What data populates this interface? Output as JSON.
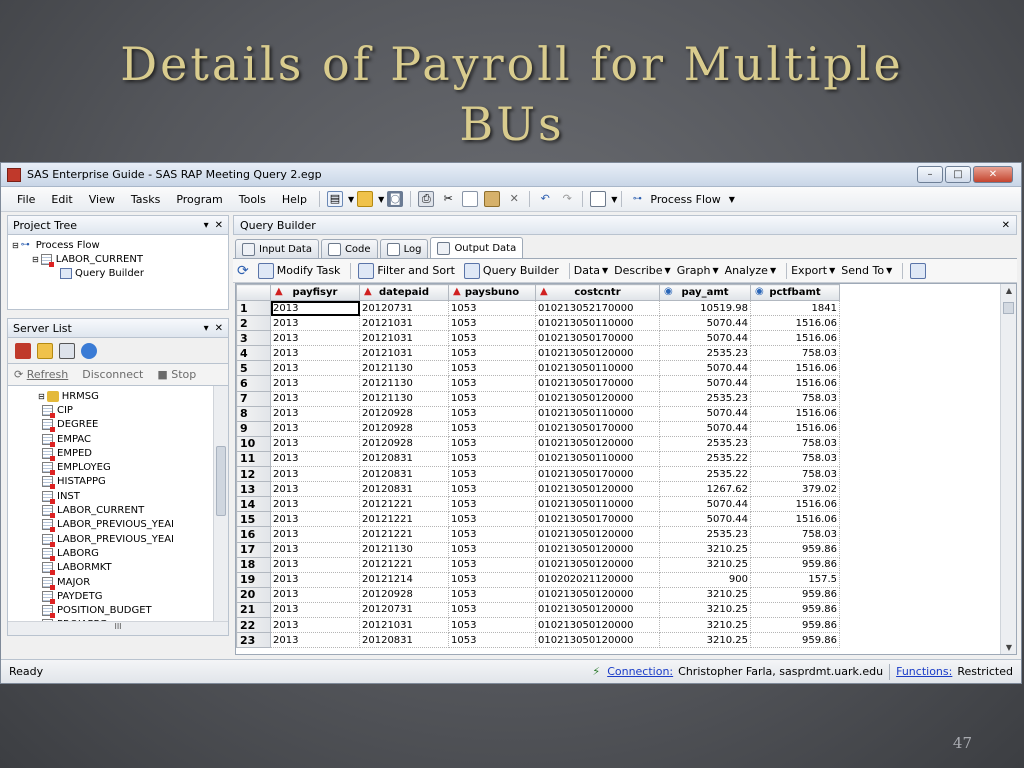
{
  "slide": {
    "title_line1": "Details of Payroll for Multiple",
    "title_line2": "BUs",
    "page_number": "47"
  },
  "window": {
    "title": "SAS Enterprise Guide - SAS RAP Meeting Query 2.egp",
    "controls": {
      "minimize": "–",
      "maximize": "□",
      "close": "✕"
    }
  },
  "menu": {
    "file": "File",
    "edit": "Edit",
    "view": "View",
    "tasks": "Tasks",
    "program": "Program",
    "tools": "Tools",
    "help": "Help",
    "process_flow": "Process Flow"
  },
  "project_tree": {
    "header": "Project Tree",
    "items": [
      "Process Flow",
      "LABOR_CURRENT",
      "Query Builder"
    ]
  },
  "server_list": {
    "header": "Server List",
    "actions": {
      "refresh": "Refresh",
      "disconnect": "Disconnect",
      "stop": "Stop"
    },
    "library": "HRMSG",
    "tables": [
      "CIP",
      "DEGREE",
      "EMPAC",
      "EMPED",
      "EMPLOYEG",
      "HISTAPPG",
      "INST",
      "LABOR_CURRENT",
      "LABOR_PREVIOUS_YEAI",
      "LABOR_PREVIOUS_YEAI",
      "LABORG",
      "LABORMKT",
      "MAJOR",
      "PAYDETG",
      "POSITION_BUDGET",
      "PROJAPPG"
    ],
    "hscroll_label": "III"
  },
  "query_builder": {
    "header": "Query Builder",
    "tabs": {
      "input_data": "Input Data",
      "code": "Code",
      "log": "Log",
      "output_data": "Output Data"
    },
    "toolbar": {
      "modify_task": "Modify Task",
      "filter_sort": "Filter and Sort",
      "query_builder": "Query Builder",
      "data": "Data",
      "describe": "Describe",
      "graph": "Graph",
      "analyze": "Analyze",
      "export": "Export",
      "send_to": "Send To"
    }
  },
  "grid": {
    "columns": [
      "payfisyr",
      "datepaid",
      "paysbuno",
      "costcntr",
      "pay_amt",
      "pctfbamt"
    ],
    "column_types": [
      "char",
      "char",
      "char",
      "char",
      "num",
      "num"
    ],
    "rows": [
      [
        "1",
        "2013",
        "20120731",
        "1053",
        "010213052170000",
        "10519.98",
        "1841"
      ],
      [
        "2",
        "2013",
        "20121031",
        "1053",
        "010213050110000",
        "5070.44",
        "1516.06"
      ],
      [
        "3",
        "2013",
        "20121031",
        "1053",
        "010213050170000",
        "5070.44",
        "1516.06"
      ],
      [
        "4",
        "2013",
        "20121031",
        "1053",
        "010213050120000",
        "2535.23",
        "758.03"
      ],
      [
        "5",
        "2013",
        "20121130",
        "1053",
        "010213050110000",
        "5070.44",
        "1516.06"
      ],
      [
        "6",
        "2013",
        "20121130",
        "1053",
        "010213050170000",
        "5070.44",
        "1516.06"
      ],
      [
        "7",
        "2013",
        "20121130",
        "1053",
        "010213050120000",
        "2535.23",
        "758.03"
      ],
      [
        "8",
        "2013",
        "20120928",
        "1053",
        "010213050110000",
        "5070.44",
        "1516.06"
      ],
      [
        "9",
        "2013",
        "20120928",
        "1053",
        "010213050170000",
        "5070.44",
        "1516.06"
      ],
      [
        "10",
        "2013",
        "20120928",
        "1053",
        "010213050120000",
        "2535.23",
        "758.03"
      ],
      [
        "11",
        "2013",
        "20120831",
        "1053",
        "010213050110000",
        "2535.22",
        "758.03"
      ],
      [
        "12",
        "2013",
        "20120831",
        "1053",
        "010213050170000",
        "2535.22",
        "758.03"
      ],
      [
        "13",
        "2013",
        "20120831",
        "1053",
        "010213050120000",
        "1267.62",
        "379.02"
      ],
      [
        "14",
        "2013",
        "20121221",
        "1053",
        "010213050110000",
        "5070.44",
        "1516.06"
      ],
      [
        "15",
        "2013",
        "20121221",
        "1053",
        "010213050170000",
        "5070.44",
        "1516.06"
      ],
      [
        "16",
        "2013",
        "20121221",
        "1053",
        "010213050120000",
        "2535.23",
        "758.03"
      ],
      [
        "17",
        "2013",
        "20121130",
        "1053",
        "010213050120000",
        "3210.25",
        "959.86"
      ],
      [
        "18",
        "2013",
        "20121221",
        "1053",
        "010213050120000",
        "3210.25",
        "959.86"
      ],
      [
        "19",
        "2013",
        "20121214",
        "1053",
        "010202021120000",
        "900",
        "157.5"
      ],
      [
        "20",
        "2013",
        "20120928",
        "1053",
        "010213050120000",
        "3210.25",
        "959.86"
      ],
      [
        "21",
        "2013",
        "20120731",
        "1053",
        "010213050120000",
        "3210.25",
        "959.86"
      ],
      [
        "22",
        "2013",
        "20121031",
        "1053",
        "010213050120000",
        "3210.25",
        "959.86"
      ],
      [
        "23",
        "2013",
        "20120831",
        "1053",
        "010213050120000",
        "3210.25",
        "959.86"
      ]
    ]
  },
  "status": {
    "ready": "Ready",
    "connection_label": "Connection:",
    "connection_value": "Christopher Farla, sasprdmt.uark.edu",
    "functions_label": "Functions:",
    "functions_value": "Restricted"
  },
  "colors": {
    "title_gold": "#d9cc8e",
    "link_blue": "#1a3cc8",
    "char_icon_red": "#d02020",
    "num_icon_blue": "#2a66b8"
  }
}
